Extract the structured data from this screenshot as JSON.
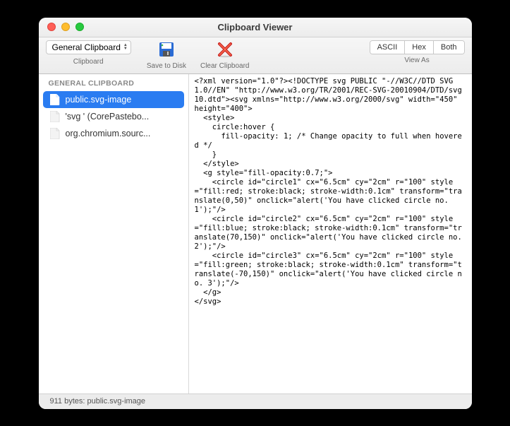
{
  "window": {
    "title": "Clipboard Viewer"
  },
  "toolbar": {
    "clipboard_select": "General Clipboard",
    "clipboard_label": "Clipboard",
    "save_label": "Save to Disk",
    "clear_label": "Clear Clipboard",
    "view_as_label": "View As",
    "seg": {
      "ascii": "ASCII",
      "hex": "Hex",
      "both": "Both"
    }
  },
  "sidebar": {
    "header": "GENERAL CLIPBOARD",
    "items": [
      {
        "label": "public.svg-image",
        "selected": true
      },
      {
        "label": "'svg ' (CorePastebo...",
        "selected": false
      },
      {
        "label": "org.chromium.sourc...",
        "selected": false
      }
    ]
  },
  "content": {
    "text": "<?xml version=\"1.0\"?><!DOCTYPE svg PUBLIC \"-//W3C//DTD SVG 1.0//EN\" \"http://www.w3.org/TR/2001/REC-SVG-20010904/DTD/svg10.dtd\"><svg xmlns=\"http://www.w3.org/2000/svg\" width=\"450\" height=\"400\">\n  <style>\n    circle:hover {\n      fill-opacity: 1; /* Change opacity to full when hovered */\n    }\n  </style>\n  <g style=\"fill-opacity:0.7;\">\n    <circle id=\"circle1\" cx=\"6.5cm\" cy=\"2cm\" r=\"100\" style=\"fill:red; stroke:black; stroke-width:0.1cm\" transform=\"translate(0,50)\" onclick=\"alert('You have clicked circle no. 1');\"/>\n    <circle id=\"circle2\" cx=\"6.5cm\" cy=\"2cm\" r=\"100\" style=\"fill:blue; stroke:black; stroke-width:0.1cm\" transform=\"translate(70,150)\" onclick=\"alert('You have clicked circle no. 2');\"/>\n    <circle id=\"circle3\" cx=\"6.5cm\" cy=\"2cm\" r=\"100\" style=\"fill:green; stroke:black; stroke-width:0.1cm\" transform=\"translate(-70,150)\" onclick=\"alert('You have clicked circle no. 3');\"/>\n  </g>\n</svg>"
  },
  "status": {
    "text": "911 bytes: public.svg-image"
  }
}
